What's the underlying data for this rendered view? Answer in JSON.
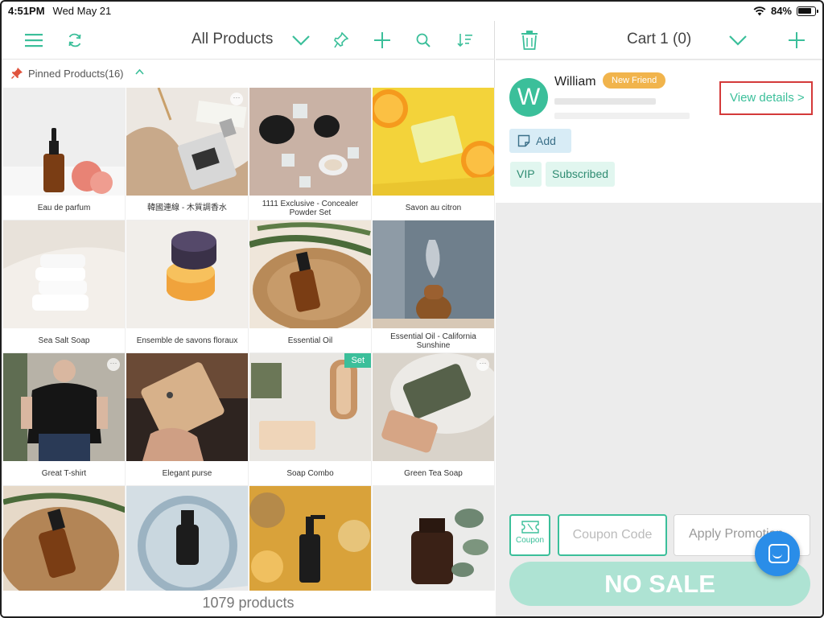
{
  "status_bar": {
    "time": "4:51PM",
    "date": "Wed May 21",
    "battery": "84%"
  },
  "left_toolbar": {
    "title": "All Products"
  },
  "pinned": {
    "label": "Pinned Products(16)"
  },
  "products": [
    {
      "name": "Eau de parfum"
    },
    {
      "name": "韓國連線 - 木質調香水"
    },
    {
      "name": "1111 Exclusive - Concealer Powder Set"
    },
    {
      "name": "Savon au citron"
    },
    {
      "name": "Sea Salt Soap"
    },
    {
      "name": "Ensemble de savons floraux"
    },
    {
      "name": "Essential Oil"
    },
    {
      "name": "Essential Oil - California Sunshine"
    },
    {
      "name": "Great T-shirt"
    },
    {
      "name": "Elegant purse"
    },
    {
      "name": "Soap Combo",
      "badge": "Set"
    },
    {
      "name": "Green Tea Soap"
    }
  ],
  "product_count": "1079 products",
  "cart": {
    "title": "Cart 1 (0)",
    "customer": {
      "initial": "W",
      "name": "William",
      "badge": "New Friend",
      "view_details": "View details >",
      "add_note": "Add",
      "tags": [
        "VIP",
        "Subscribed"
      ]
    },
    "coupon_label": "Coupon",
    "coupon_placeholder": "Coupon Code",
    "apply_promotion": "Apply Promotion",
    "no_sale": "NO SALE"
  },
  "colors": {
    "accent": "#3bbf9a",
    "badge_orange": "#f1b44c",
    "highlight_red": "#d43a3a",
    "chat_blue": "#2a8de8"
  }
}
